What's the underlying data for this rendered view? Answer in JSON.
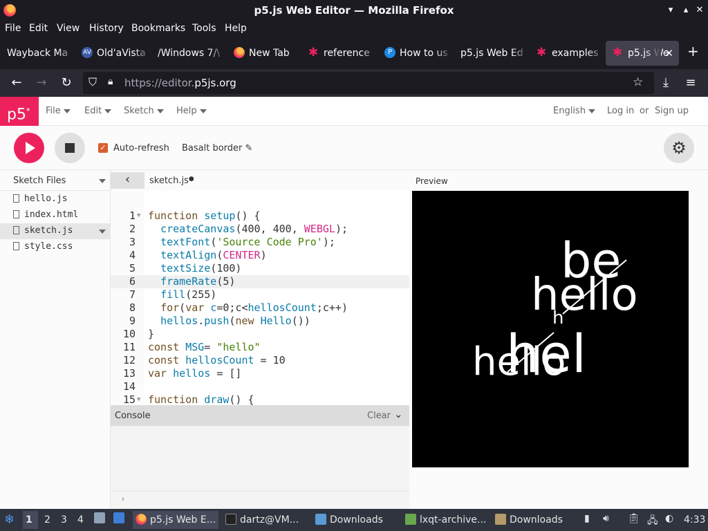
{
  "window": {
    "title": "p5.js Web Editor — Mozilla Firefox"
  },
  "menubar": [
    "File",
    "Edit",
    "View",
    "History",
    "Bookmarks",
    "Tools",
    "Help"
  ],
  "tabs": [
    {
      "label": "Wayback Ma"
    },
    {
      "label": "Old'aVista"
    },
    {
      "label": "/Windows 7/\\"
    },
    {
      "label": "New Tab"
    },
    {
      "label": "reference"
    },
    {
      "label": "How to us"
    },
    {
      "label": "p5.js Web Ed"
    },
    {
      "label": "examples"
    },
    {
      "label": "p5.js We"
    }
  ],
  "url": {
    "prefix": "https://editor.",
    "host": "p5js.org"
  },
  "p5": {
    "logo": "p5",
    "menus": [
      "File",
      "Edit",
      "Sketch",
      "Help"
    ],
    "language": "English",
    "login": "Log in",
    "or": "or",
    "signup": "Sign up",
    "auto_refresh": "Auto-refresh",
    "sketch_name": "Basalt border",
    "sketch_files": "Sketch Files",
    "files": [
      "hello.js",
      "index.html",
      "sketch.js",
      "style.css"
    ],
    "open_file": "sketch.js",
    "preview": "Preview",
    "console": "Console",
    "clear": "Clear"
  },
  "code_lines": [
    [
      [
        "kw",
        "function "
      ],
      [
        "fn",
        "setup"
      ],
      [
        "pl",
        "() {"
      ]
    ],
    [
      [
        "pl",
        "  "
      ],
      [
        "fn",
        "createCanvas"
      ],
      [
        "pl",
        "(400, 400, "
      ],
      [
        "con",
        "WEBGL"
      ],
      [
        "pl",
        ");"
      ]
    ],
    [
      [
        "pl",
        "  "
      ],
      [
        "fn",
        "textFont"
      ],
      [
        "pl",
        "("
      ],
      [
        "str",
        "'Source Code Pro'"
      ],
      [
        "pl",
        ");"
      ]
    ],
    [
      [
        "pl",
        "  "
      ],
      [
        "fn",
        "textAlign"
      ],
      [
        "pl",
        "("
      ],
      [
        "con",
        "CENTER"
      ],
      [
        "pl",
        ")"
      ]
    ],
    [
      [
        "pl",
        "  "
      ],
      [
        "fn",
        "textSize"
      ],
      [
        "pl",
        "(100)"
      ]
    ],
    [
      [
        "pl",
        "  "
      ],
      [
        "fn",
        "frameRate"
      ],
      [
        "pl",
        "(5)"
      ]
    ],
    [
      [
        "pl",
        "  "
      ],
      [
        "fn",
        "fill"
      ],
      [
        "pl",
        "(255)"
      ]
    ],
    [
      [
        "pl",
        "  "
      ],
      [
        "kw",
        "for"
      ],
      [
        "pl",
        "("
      ],
      [
        "kw",
        "var "
      ],
      [
        "var",
        "c"
      ],
      [
        "pl",
        "=0;c<"
      ],
      [
        "var",
        "hellosCount"
      ],
      [
        "pl",
        ";c++)"
      ]
    ],
    [
      [
        "pl",
        "  "
      ],
      [
        "var",
        "hellos"
      ],
      [
        "pl",
        "."
      ],
      [
        "fn",
        "push"
      ],
      [
        "pl",
        "("
      ],
      [
        "kw",
        "new "
      ],
      [
        "fn",
        "Hello"
      ],
      [
        "pl",
        "())"
      ]
    ],
    [
      [
        "pl",
        "}"
      ]
    ],
    [
      [
        "kw",
        "const "
      ],
      [
        "var",
        "MSG"
      ],
      [
        "pl",
        "= "
      ],
      [
        "str",
        "\"hello\""
      ]
    ],
    [
      [
        "kw",
        "const "
      ],
      [
        "var",
        "hellosCount"
      ],
      [
        "pl",
        " = 10"
      ]
    ],
    [
      [
        "kw",
        "var "
      ],
      [
        "var",
        "hellos"
      ],
      [
        "pl",
        " = []"
      ]
    ],
    [
      [
        "pl",
        ""
      ]
    ],
    [
      [
        "kw",
        "function "
      ],
      [
        "fn",
        "draw"
      ],
      [
        "pl",
        "() {"
      ]
    ]
  ],
  "preview_words": [
    "be",
    "hello",
    "h",
    "hel",
    "hello"
  ],
  "taskbar": {
    "workspaces": [
      "1",
      "2",
      "3",
      "4"
    ],
    "items": [
      "p5.js Web E...",
      "dartz@VM...",
      "Downloads",
      "lxqt-archive...",
      "Downloads"
    ],
    "clock": "4:33"
  },
  "colors": {
    "p5_pink": "#ed225d",
    "firefox_dark": "#1c1b22",
    "toolbar": "#2b2a33"
  }
}
